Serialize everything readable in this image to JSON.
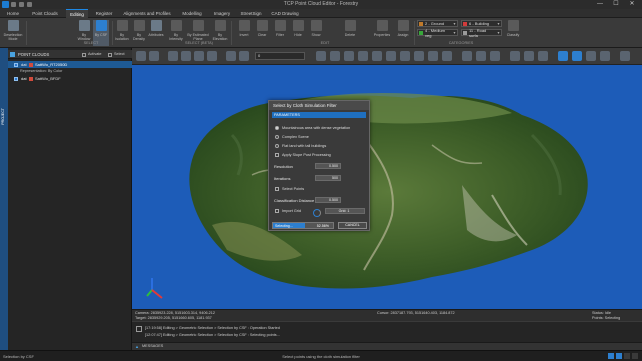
{
  "window": {
    "title": "TCP Point Cloud Editor - Forestry",
    "controls": [
      "—",
      "☐",
      "✕"
    ]
  },
  "ribbon_tabs": [
    {
      "label": "Home"
    },
    {
      "label": "Point Clouds"
    },
    {
      "label": "Editing"
    },
    {
      "label": "Register"
    },
    {
      "label": "Alignments and Profiles"
    },
    {
      "label": "Modelling"
    },
    {
      "label": "Imagery"
    },
    {
      "label": "StreetSign"
    },
    {
      "label": "CAD Drawing"
    }
  ],
  "ribbon": {
    "buttons": [
      {
        "label": "Deselection Mode"
      },
      {
        "label": "By Window"
      },
      {
        "label": "By CSF"
      },
      {
        "label": "By Isolation"
      },
      {
        "label": "By Density"
      },
      {
        "label": "Attributes"
      },
      {
        "label": "By Intensity"
      },
      {
        "label": "By Estimated Plane"
      },
      {
        "label": "By Elevation"
      },
      {
        "label": "Invert"
      },
      {
        "label": "Clear"
      },
      {
        "label": "Filter"
      },
      {
        "label": "Hide"
      },
      {
        "label": "Show"
      },
      {
        "label": "Delete"
      },
      {
        "label": "Properties"
      },
      {
        "label": "Assign"
      },
      {
        "label": "Classify"
      }
    ],
    "groups": [
      "SELECT",
      "SELECT (BETA)",
      "EDIT",
      "CATEGORIES"
    ],
    "categories": [
      {
        "label": "2 - Ground",
        "color": "#c07a2a"
      },
      {
        "label": "6 - Building",
        "color": "#d23b3b"
      },
      {
        "label": "4 - Medium veg",
        "color": "#38a83a"
      },
      {
        "label": "11 - Road surfa",
        "color": "#9a9a9a"
      }
    ]
  },
  "side_panel": {
    "strip_label": "PROJECT",
    "title": "POINT CLOUDS",
    "activate_label": "Activate",
    "select_label": "Select",
    "items": [
      {
        "tag": "dat",
        "name": "SattWo_RT2050D"
      },
      {
        "tag": "dat",
        "name": "SattWo_BFDF"
      }
    ],
    "sub_label": "Representation: By Color"
  },
  "viewport": {
    "zoom_dropdown": "0"
  },
  "dialog": {
    "title": "Select by Cloth Simulation Filter",
    "section": "PARAMETERS",
    "options": [
      {
        "label": "Mountainous area with dense vegetation",
        "checked": true
      },
      {
        "label": "Complex Scene",
        "checked": false
      },
      {
        "label": "Flat land with tall buildings",
        "checked": false
      }
    ],
    "post_processing_label": "Apply Slope Post Processing",
    "resolution_label": "Resolution",
    "resolution_value": "0.500",
    "iterations_label": "Iterations",
    "iterations_value": "500",
    "select_points_label": "Select Points",
    "class_distance_label": "Classification Distance",
    "class_distance_value": "0.500",
    "import_grid_label": "Import Grid",
    "grid_field_value": "Grid: 1",
    "progress_label": "Selecting...",
    "progress_pct_label": "52.56%",
    "progress_fraction": 0.5256,
    "cancel_label": "CANCEL"
  },
  "view_status": {
    "camera": "Camera: 2835923.228, 5151603.314, 9406.212",
    "target": "Target: 2835929.205, 5151660.605, 1181.937",
    "cursor": "Cursor: 2837187.793, 5151640.403, 1184.872",
    "status": "Status: Idle",
    "points": "Points: Selecting"
  },
  "messages": {
    "lines": [
      "[17:19:58] Editing > Geometric Selection > Selection by CSF : Operation Started",
      "[12:07:47] Editing > Geometric Selection > Selection by CSF : Selecting points..."
    ],
    "bar_label": "MESSAGES"
  },
  "statusbar": {
    "left": "Selection by CSF",
    "center": "Select points using the cloth simulation filter"
  }
}
